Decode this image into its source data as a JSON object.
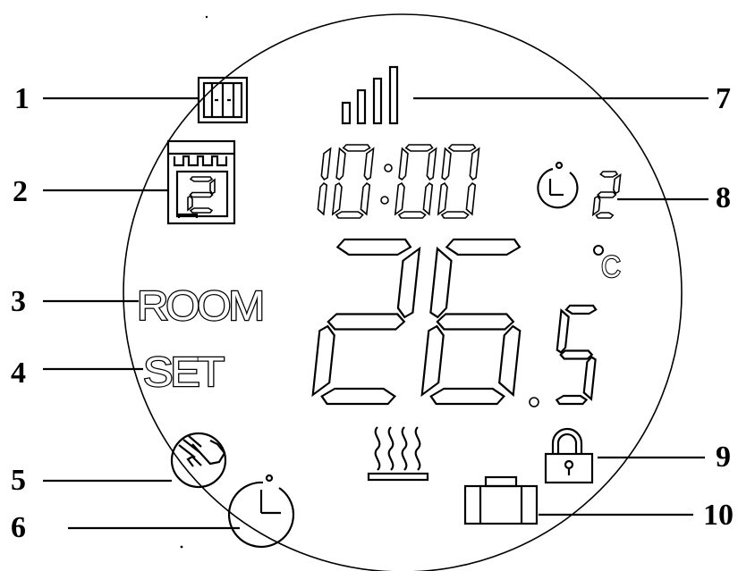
{
  "display": {
    "time": "10:00",
    "temperature": "26.5",
    "unit": "°C",
    "room_label": "ROOM",
    "set_label": "SET",
    "calendar_day": "2",
    "program_number": "2"
  },
  "icons": [
    "window-icon",
    "calendar-day-icon",
    "hand-icon",
    "clock-icon",
    "signal-bars-icon",
    "clock-program-icon",
    "heating-icon",
    "lock-icon",
    "briefcase-icon"
  ],
  "callouts": [
    "1",
    "2",
    "3",
    "4",
    "5",
    "6",
    "7",
    "8",
    "9",
    "10"
  ]
}
